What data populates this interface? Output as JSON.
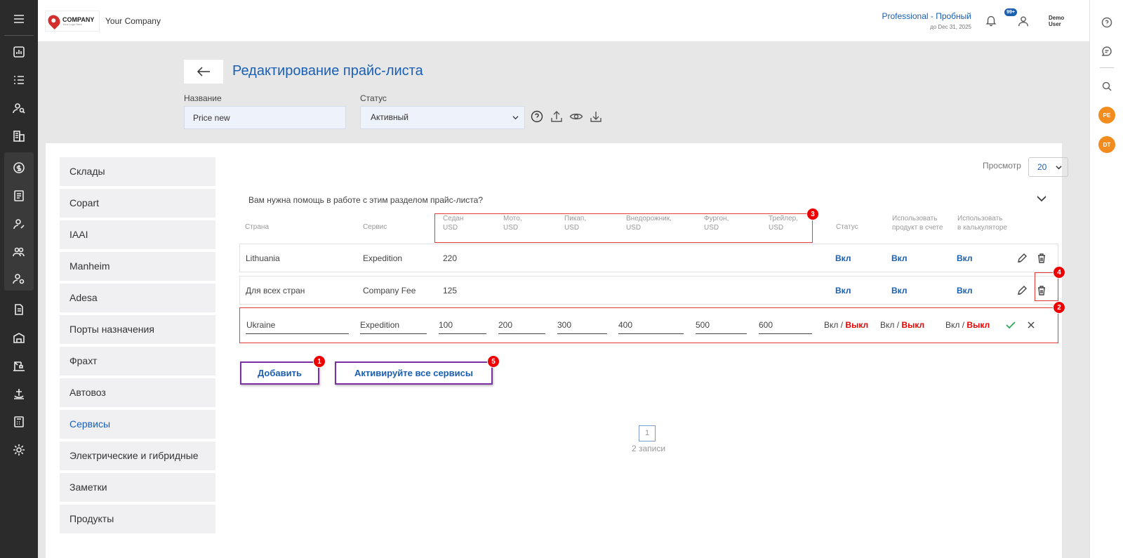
{
  "header": {
    "logo_big": "COMPANY",
    "logo_small": "Your Logo Here",
    "company_name": "Your Company",
    "plan_title": "Professional - Пробный",
    "plan_date": "до Dec 31, 2025",
    "notifications_badge": "99+",
    "user_first": "Demo",
    "user_last": "User"
  },
  "right_rail": {
    "badges": [
      "PE",
      "DT"
    ]
  },
  "page": {
    "title": "Редактирование прайс-листа",
    "name_label": "Название",
    "name_value": "Price new",
    "status_label": "Статус",
    "status_value": "Активный"
  },
  "sidemenu": [
    "Склады",
    "Copart",
    "IAAI",
    "Manheim",
    "Adesa",
    "Порты назначения",
    "Фрахт",
    "Автовоз",
    "Сервисы",
    "Электрические и гибридные",
    "Заметки",
    "Продукты"
  ],
  "sidemenu_active": "Сервисы",
  "view": {
    "label": "Просмотр",
    "value": "20"
  },
  "help_text": "Вам нужна помощь в работе с этим разделом прайс-листа?",
  "table": {
    "headers": {
      "country": "Страна",
      "service": "Сервис",
      "sedan": [
        "Седан",
        "USD"
      ],
      "moto": [
        "Мото,",
        "USD"
      ],
      "pickup": [
        "Пикап,",
        "USD"
      ],
      "suv": [
        "Внедорожник,",
        "USD"
      ],
      "van": [
        "Фургон,",
        "USD"
      ],
      "trailer": [
        "Трейлер,",
        "USD"
      ],
      "status": "Статус",
      "invoice": [
        "Использовать",
        "продукт в счете"
      ],
      "calc": [
        "Использовать",
        "в калькуляторе"
      ]
    },
    "rows": [
      {
        "country": "Lithuania",
        "service": "Expedition",
        "sedan": "220",
        "status": "Вкл",
        "invoice": "Вкл",
        "calc": "Вкл"
      },
      {
        "country": "Для всех стран",
        "service": "Company Fee",
        "sedan": "125",
        "status": "Вкл",
        "invoice": "Вкл",
        "calc": "Вкл"
      }
    ],
    "edit_row": {
      "country": "Ukraine",
      "service": "Expedition",
      "sedan": "100",
      "moto": "200",
      "pickup": "300",
      "suv": "400",
      "van": "500",
      "trailer": "600",
      "on": "Вкл",
      "sep": "/",
      "off": "Выкл"
    }
  },
  "buttons": {
    "add": "Добавить",
    "activate_all": "Активируйте все сервисы"
  },
  "annotations": [
    "1",
    "2",
    "3",
    "4",
    "5"
  ],
  "pagination": {
    "page": "1",
    "records": "2 записи"
  },
  "colors": {
    "accent": "#1a5fb4",
    "danger": "#e00",
    "highlight": "#e53935",
    "button_border": "#7b2fa1"
  }
}
